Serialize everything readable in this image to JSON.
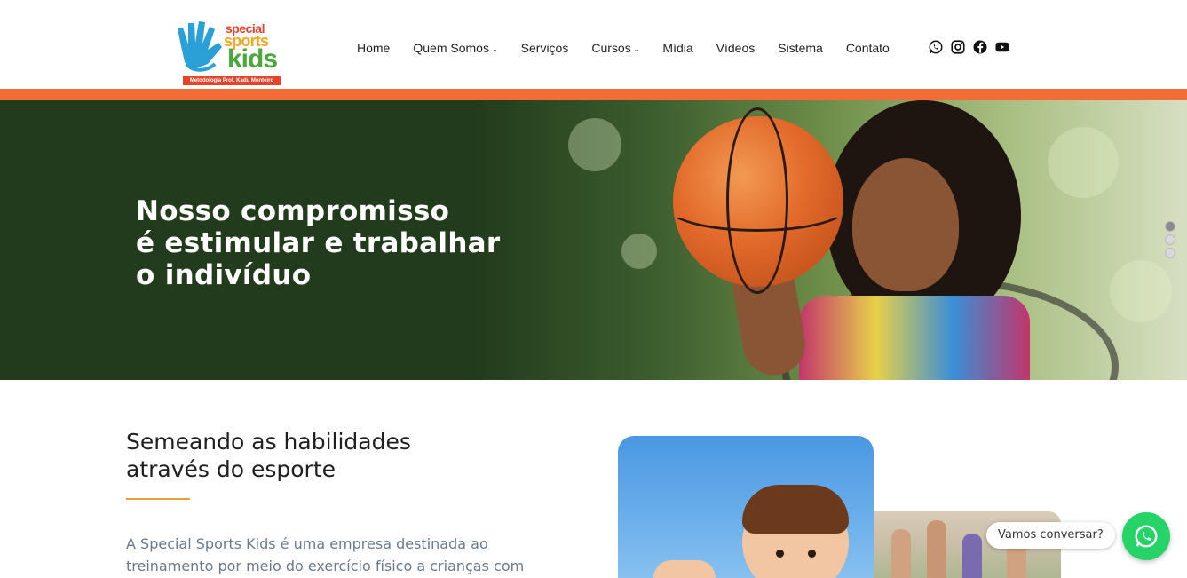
{
  "brand": {
    "line1": "special",
    "line2": "sports",
    "line3": "kids",
    "tagline": "Metodologia Prof. Kadu Monteiro"
  },
  "nav": {
    "items": [
      {
        "label": "Home",
        "dropdown": false
      },
      {
        "label": "Quem Somos",
        "dropdown": true
      },
      {
        "label": "Serviços",
        "dropdown": false
      },
      {
        "label": "Cursos",
        "dropdown": true
      },
      {
        "label": "Mídia",
        "dropdown": false
      },
      {
        "label": "Vídeos",
        "dropdown": false
      },
      {
        "label": "Sistema",
        "dropdown": false
      },
      {
        "label": "Contato",
        "dropdown": false
      }
    ],
    "social": [
      "whatsapp-icon",
      "instagram-icon",
      "facebook-icon",
      "youtube-icon"
    ]
  },
  "hero": {
    "lines": [
      "Nosso compromisso",
      "é estimular e trabalhar",
      "o indivíduo"
    ],
    "slides_count": 3,
    "active_slide": 1
  },
  "about": {
    "title_lines": [
      "Semeando as habilidades",
      "através do esporte"
    ],
    "paragraph_lines": [
      "A Special Sports Kids é uma empresa destinada ao",
      "treinamento por meio do exercício físico a crianças com"
    ]
  },
  "chat": {
    "bubble": "Vamos conversar?"
  },
  "colors": {
    "accent_orange": "#f26c35",
    "accent_gold": "#e3a23a",
    "whatsapp_green": "#25d366",
    "hero_dark": "#223b1c"
  }
}
